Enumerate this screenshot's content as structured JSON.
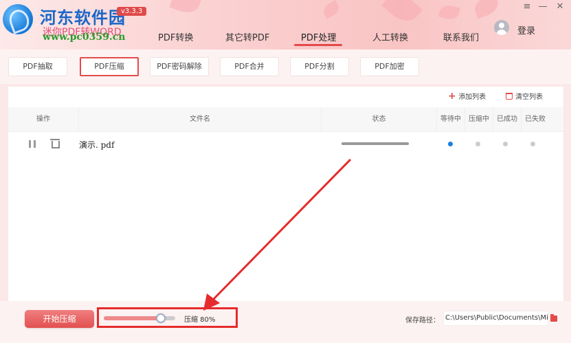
{
  "brand": {
    "title": "河东软件园",
    "app_name": "迷你PDF转WORD",
    "url": "www.pc0359.cn",
    "version": "v3.3.3"
  },
  "nav": {
    "items": [
      {
        "label": "PDF转换"
      },
      {
        "label": "其它转PDF"
      },
      {
        "label": "PDF处理"
      },
      {
        "label": "人工转换"
      },
      {
        "label": "联系我们"
      }
    ],
    "active_index": 2,
    "login_label": "登录"
  },
  "window": {
    "menu_icon": "≡",
    "minimize_icon": "—",
    "close_icon": "✕"
  },
  "subtabs": {
    "items": [
      {
        "label": "PDF抽取"
      },
      {
        "label": "PDF压缩"
      },
      {
        "label": "PDF密码解除"
      },
      {
        "label": "PDF合并"
      },
      {
        "label": "PDF分割"
      },
      {
        "label": "PDF加密"
      }
    ],
    "active_index": 1
  },
  "toolbar": {
    "add_label": "添加列表",
    "clear_label": "清空列表"
  },
  "table": {
    "columns": {
      "op": "操作",
      "filename": "文件名",
      "status": "状态",
      "waiting": "等待中",
      "compressing": "压缩中",
      "done": "已成功",
      "failed": "已失败"
    },
    "rows": [
      {
        "filename": "演示. pdf",
        "progress": 1.0,
        "state": "waiting"
      }
    ]
  },
  "bottom": {
    "start_label": "开始压缩",
    "compress_label": "压缩 80%",
    "compress_level": 0.8,
    "save_label": "保存路径：",
    "save_path": "C:\\Users\\Public\\Documents\\Mini"
  },
  "colors": {
    "accent": "#e24a4a",
    "active_dot": "#1a7fe0",
    "brand_blue": "#1a66c8",
    "brand_green": "#2a9a2a"
  }
}
